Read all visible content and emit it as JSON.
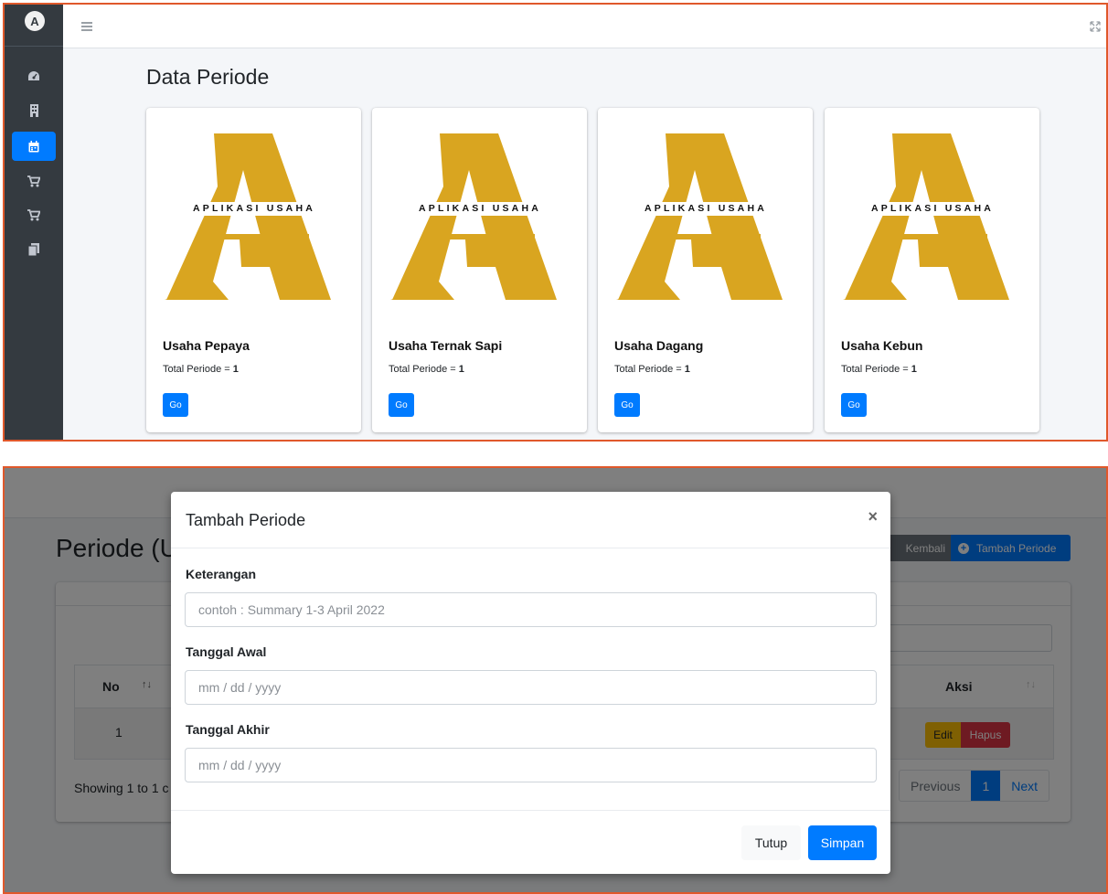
{
  "app": {
    "brand_letter": "A",
    "sidebar_items": [
      {
        "icon": "dashboard-icon"
      },
      {
        "icon": "building-icon"
      },
      {
        "icon": "calendar-icon",
        "active": true
      },
      {
        "icon": "cart-icon"
      },
      {
        "icon": "cart-icon"
      },
      {
        "icon": "copy-icon"
      }
    ]
  },
  "panel1": {
    "page_title": "Data Periode",
    "cards": [
      {
        "logo_text": "APLIKASI USAHA",
        "title": "Usaha Pepaya",
        "total_label": "Total Periode = ",
        "total_value": "1",
        "button": "Go"
      },
      {
        "logo_text": "APLIKASI USAHA",
        "title": "Usaha Ternak Sapi",
        "total_label": "Total Periode = ",
        "total_value": "1",
        "button": "Go"
      },
      {
        "logo_text": "APLIKASI USAHA",
        "title": "Usaha Dagang",
        "total_label": "Total Periode = ",
        "total_value": "1",
        "button": "Go"
      },
      {
        "logo_text": "APLIKASI USAHA",
        "title": "Usaha Kebun",
        "total_label": "Total Periode = ",
        "total_value": "1",
        "button": "Go"
      }
    ]
  },
  "panel2": {
    "heading": "Periode (U",
    "btn_kembali": "Kembali",
    "btn_tambah": "Tambah Periode",
    "table": {
      "headers": [
        "No",
        "Aksi"
      ],
      "rows": [
        {
          "no": "1",
          "edit": "Edit",
          "hapus": "Hapus"
        }
      ]
    },
    "showing": "Showing 1 to 1 c",
    "pagination": {
      "previous": "Previous",
      "current": "1",
      "next": "Next"
    },
    "modal": {
      "title": "Tambah Periode",
      "close": "×",
      "fields": [
        {
          "label": "Keterangan",
          "placeholder": "contoh : Summary 1-3 April 2022"
        },
        {
          "label": "Tanggal Awal",
          "placeholder": "mm / dd / yyyy"
        },
        {
          "label": "Tanggal Akhir",
          "placeholder": "mm / dd / yyyy"
        }
      ],
      "btn_tutup": "Tutup",
      "btn_simpan": "Simpan"
    }
  },
  "colors": {
    "primary": "#007bff",
    "logo_gold": "#d9a520",
    "sidebar": "#343a40",
    "frame_border": "#e0582b",
    "edit": "#ffc107",
    "hapus": "#dc3545"
  }
}
